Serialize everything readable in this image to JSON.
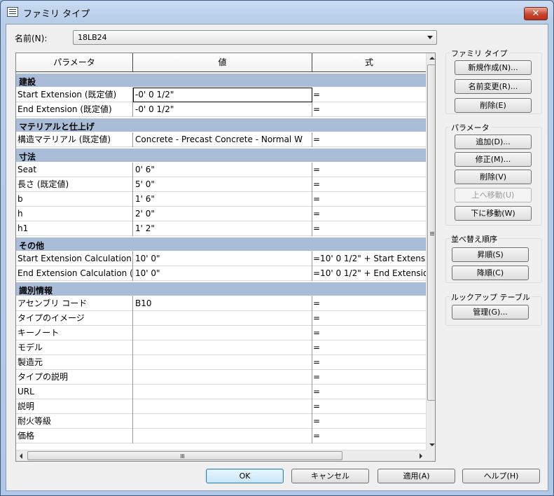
{
  "window": {
    "title": "ファミリ タイプ",
    "close_label": "✕"
  },
  "name": {
    "label": "名前(N):",
    "value": "18LB24"
  },
  "grid": {
    "headers": [
      "パラメータ",
      "値",
      "式"
    ],
    "rows": [
      {
        "type": "group",
        "label": "建設"
      },
      {
        "type": "param",
        "name": "Start Extension (既定値)",
        "value": "-0'  0 1/2\"",
        "formula": "=",
        "active": true
      },
      {
        "type": "param",
        "name": "End Extension (既定値)",
        "value": "-0'  0 1/2\"",
        "formula": "="
      },
      {
        "type": "group",
        "label": "マテリアルと仕上げ"
      },
      {
        "type": "param",
        "name": "構造マテリアル (既定値)",
        "value": "Concrete - Precast Concrete - Normal W",
        "formula": "="
      },
      {
        "type": "group",
        "label": "寸法"
      },
      {
        "type": "param",
        "name": "Seat",
        "value": "0'  6\"",
        "formula": "="
      },
      {
        "type": "param",
        "name": "長さ (既定値)",
        "value": "5'  0\"",
        "formula": "="
      },
      {
        "type": "param",
        "name": "b",
        "value": "1'  6\"",
        "formula": "="
      },
      {
        "type": "param",
        "name": "h",
        "value": "2'  0\"",
        "formula": "="
      },
      {
        "type": "param",
        "name": "h1",
        "value": "1'  2\"",
        "formula": "="
      },
      {
        "type": "group",
        "label": "その他"
      },
      {
        "type": "param",
        "name": "Start Extension Calculation",
        "value": "10'  0\"",
        "formula": "=10'  0 1/2\" + Start Extens"
      },
      {
        "type": "param",
        "name": "End Extension Calculation (",
        "value": "10'  0\"",
        "formula": "=10'  0 1/2\" + End Extensio"
      },
      {
        "type": "group",
        "label": "識別情報"
      },
      {
        "type": "param",
        "name": "アセンブリ コード",
        "value": "B10",
        "formula": "="
      },
      {
        "type": "param",
        "name": "タイプのイメージ",
        "value": "",
        "formula": "="
      },
      {
        "type": "param",
        "name": "キーノート",
        "value": "",
        "formula": "="
      },
      {
        "type": "param",
        "name": "モデル",
        "value": "",
        "formula": "="
      },
      {
        "type": "param",
        "name": "製造元",
        "value": "",
        "formula": "="
      },
      {
        "type": "param",
        "name": "タイプの説明",
        "value": "",
        "formula": "="
      },
      {
        "type": "param",
        "name": "URL",
        "value": "",
        "formula": "="
      },
      {
        "type": "param",
        "name": "説明",
        "value": "",
        "formula": "="
      },
      {
        "type": "param",
        "name": "耐火等級",
        "value": "",
        "formula": "="
      },
      {
        "type": "param",
        "name": "価格",
        "value": "",
        "formula": "="
      }
    ]
  },
  "family_types": {
    "title": "ファミリ タイプ",
    "new": "新規作成(N)...",
    "rename": "名前変更(R)...",
    "delete": "削除(E)"
  },
  "parameters": {
    "title": "パラメータ",
    "add": "追加(D)...",
    "modify": "修正(M)...",
    "remove": "削除(V)",
    "move_up": "上へ移動(U)",
    "move_down": "下に移動(W)"
  },
  "sort_order": {
    "title": "並べ替え順序",
    "ascending": "昇順(S)",
    "descending": "降順(C)"
  },
  "lookup": {
    "title": "ルックアップ テーブル",
    "manage": "管理(G)..."
  },
  "footer": {
    "ok": "OK",
    "cancel": "キャンセル",
    "apply": "適用(A)",
    "help": "ヘルプ(H)"
  }
}
